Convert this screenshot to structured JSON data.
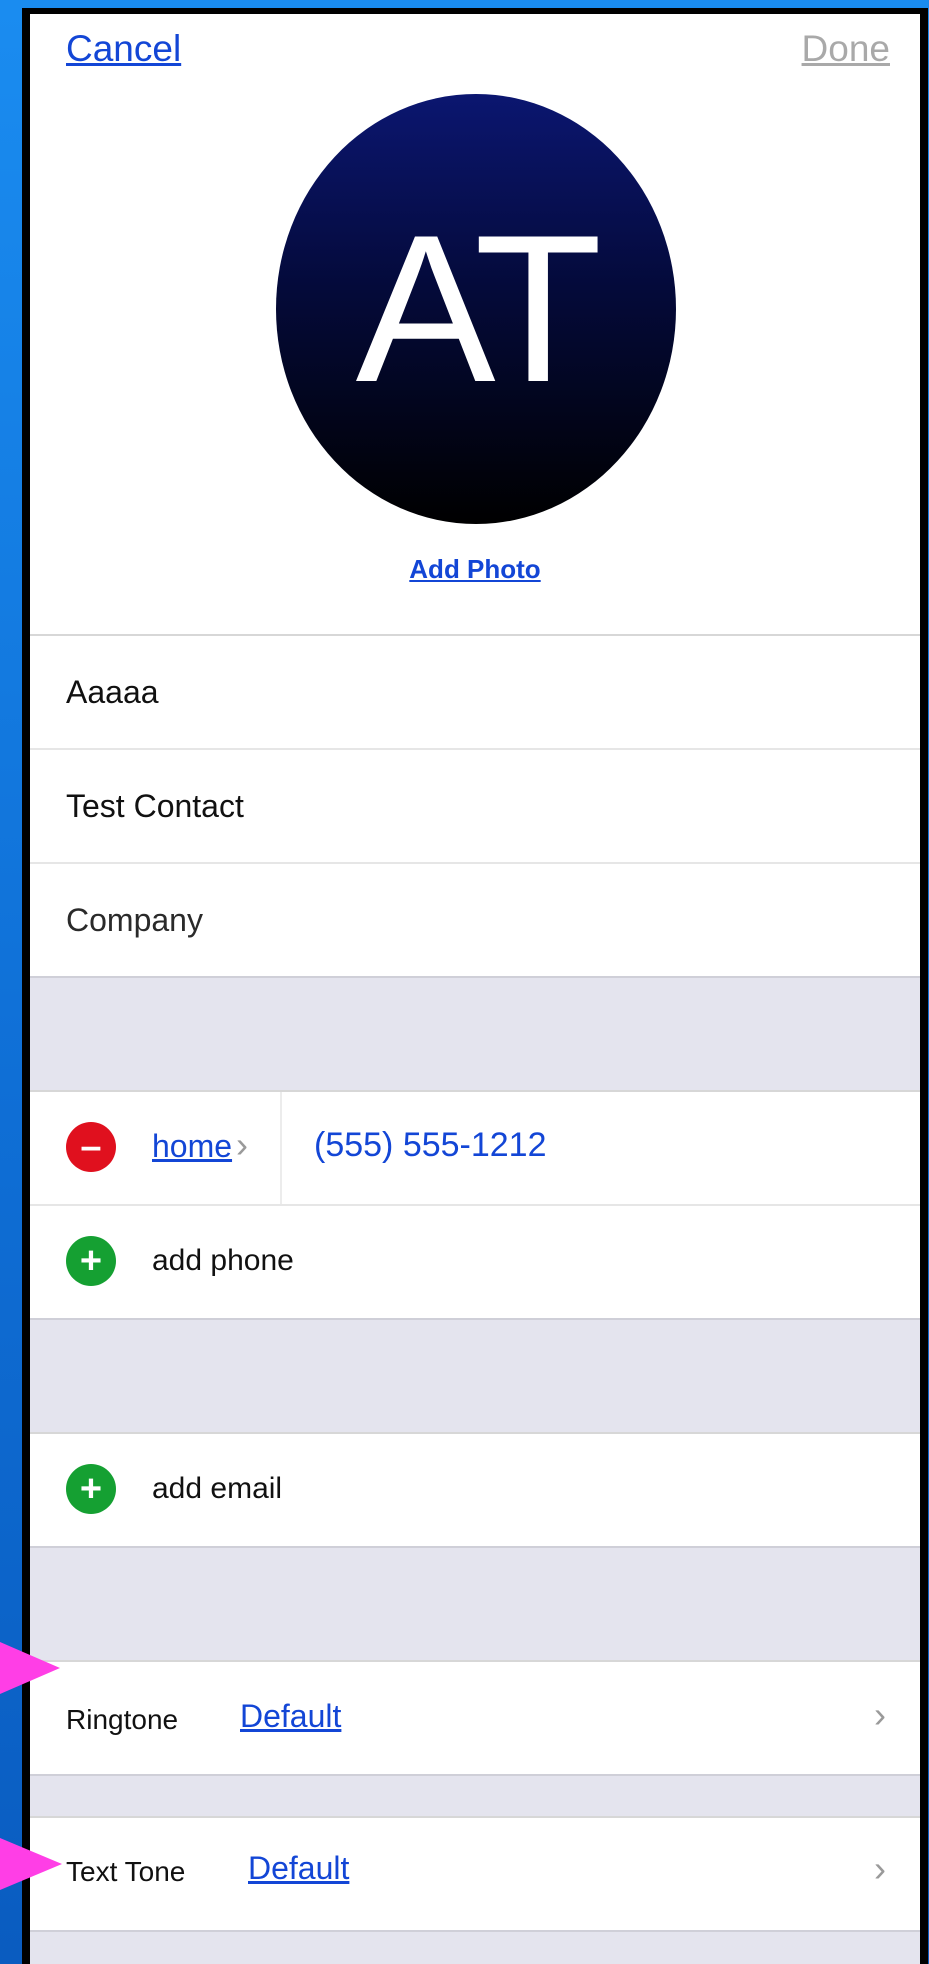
{
  "nav": {
    "cancel": "Cancel",
    "done": "Done"
  },
  "avatar": {
    "initials": "AT"
  },
  "add_photo": "Add Photo",
  "name_fields": {
    "first": "Aaaaa",
    "last": "Test Contact",
    "company": "Company"
  },
  "phone": {
    "label": "home",
    "number": "(555) 555-1212",
    "add": "add phone"
  },
  "email": {
    "add": "add email"
  },
  "ringtone": {
    "label": "Ringtone",
    "value": "Default"
  },
  "text_tone": {
    "label": "Text Tone",
    "value": "Default"
  },
  "chevron": "›",
  "colors": {
    "link": "#1346d6",
    "minus": "#e0101e",
    "plus": "#15a032",
    "arrow": "#ff3ee6",
    "background": "#1a8cf0"
  }
}
